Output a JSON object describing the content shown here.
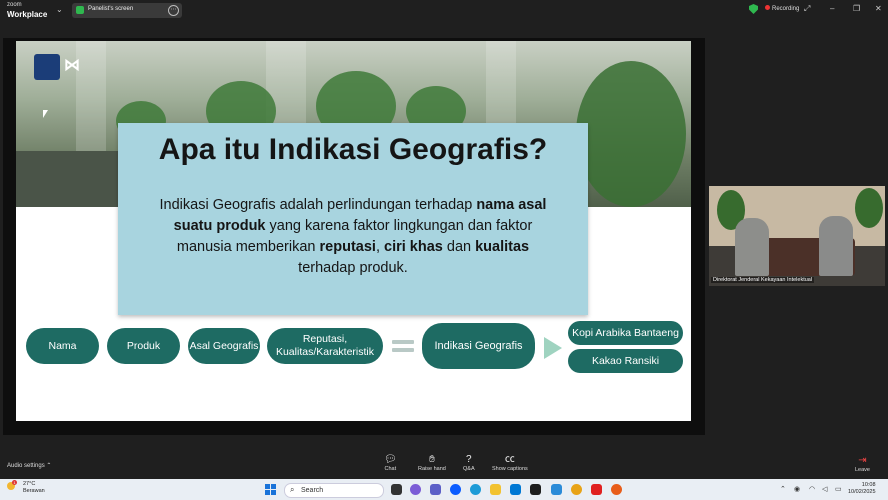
{
  "app": {
    "logo_line1": "zoom",
    "logo_line2": "Workplace"
  },
  "topbar": {
    "share_tab_label": "Panelist's screen",
    "recording_label": "Recording"
  },
  "slide": {
    "title": "Apa itu Indikasi Geografis?",
    "body": {
      "p1": "Indikasi Geografis adalah perlindungan terhadap ",
      "b1": "nama asal suatu produk",
      "p2": " yang karena faktor lingkungan dan faktor manusia memberikan ",
      "b2": "reputasi",
      "p3": ", ",
      "b3": "ciri khas",
      "p4": " dan ",
      "b4": "kualitas",
      "p5": " terhadap produk."
    },
    "flow": {
      "nama": "Nama",
      "produk": "Produk",
      "asal": "Asal Geografis",
      "reputasi": "Reputasi, Kualitas/Karakteristik",
      "result": "Indikasi Geografis",
      "example1": "Kopi Arabika Bantaeng",
      "example2": "Kakao Ransiki"
    }
  },
  "video": {
    "participant_name": "Direktorat Jenderal Kekayaan Intelektual"
  },
  "controls": {
    "audio_settings": "Audio settings",
    "chat": "Chat",
    "raise_hand": "Raise hand",
    "qa": "Q&A",
    "show_captions": "Show captions",
    "leave": "Leave"
  },
  "taskbar": {
    "weather_temp": "27°C",
    "weather_desc": "Berawan",
    "weather_badge": "1",
    "search_placeholder": "Search",
    "time": "10:08",
    "date": "10/02/2025"
  },
  "colors": {
    "card_bg": "#a8d4df",
    "pill_bg": "#1e6b63",
    "recording": "#e33333"
  }
}
